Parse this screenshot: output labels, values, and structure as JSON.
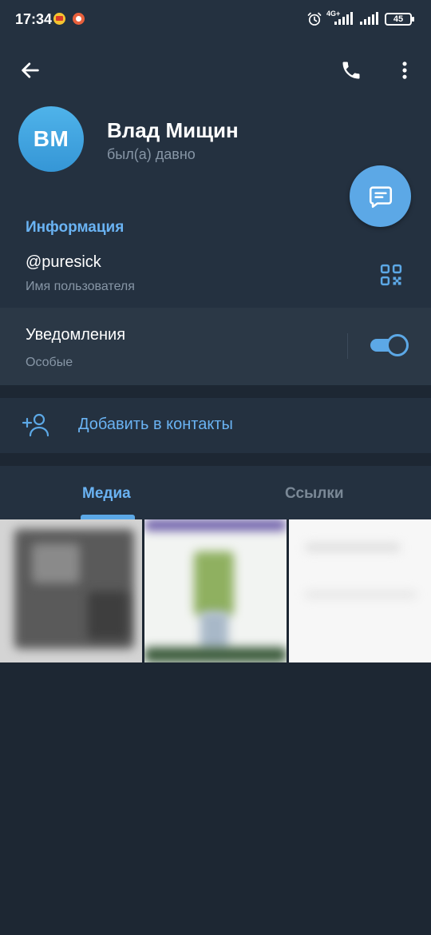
{
  "status_bar": {
    "time": "17:34",
    "network": "4G+",
    "battery": "45"
  },
  "header": {
    "back_icon": "arrow-left-icon",
    "call_icon": "phone-icon",
    "menu_icon": "more-vert-icon"
  },
  "profile": {
    "initials": "ВМ",
    "name": "Влад Мищин",
    "status": "был(а) давно"
  },
  "info": {
    "section_title": "Информация",
    "username": "@puresick",
    "username_label": "Имя пользователя"
  },
  "notifications": {
    "title": "Уведомления",
    "subtitle": "Особые",
    "enabled": true
  },
  "add_contact": {
    "label": "Добавить в контакты"
  },
  "tabs": {
    "items": [
      {
        "label": "Медиа",
        "active": true
      },
      {
        "label": "Ссылки",
        "active": false
      }
    ]
  },
  "colors": {
    "background": "#1d2733",
    "surface": "#243140",
    "accent": "#5ca8e6",
    "accent_text": "#6ab3f3",
    "secondary_text": "#8796a6"
  }
}
